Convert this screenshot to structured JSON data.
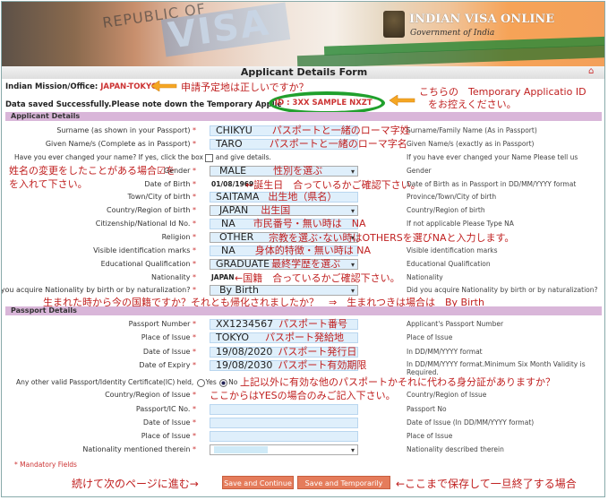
{
  "banner": {
    "title": "INDIAN VISA ONLINE",
    "subtitle": "Government of India"
  },
  "form_title": "Applicant Details Form",
  "mission": {
    "label": "Indian Mission/Office:",
    "value": "JAPAN-TOKYO"
  },
  "saved": {
    "text": "Data saved Successfully.Please note down the Temporary Applic",
    "id_label": "ID :",
    "id_value": "3XX SAMPLE NXZT"
  },
  "sections": {
    "applicant": "Applicant Details",
    "passport": "Passport Details"
  },
  "fields": {
    "surname": {
      "label": "Surname (as shown in your Passport)",
      "value": "CHIKYU",
      "hint": "Surname/Family Name (As in Passport)"
    },
    "given": {
      "label": "Given Name/s (Complete as in Passport)",
      "value": "TARO",
      "hint": "Given Name/s (exactly as in Passport)"
    },
    "changed": {
      "label": "Have you ever changed your name? If yes, click the box",
      "label2": "and give details.",
      "hint": "If you have ever changed your Name Please tell us"
    },
    "gender": {
      "label": "Gender",
      "value": "MALE",
      "hint": "Gender"
    },
    "dob": {
      "label": "Date of Birth",
      "value": "01/08/1969",
      "hint": "Date of Birth as in Passport in DD/MM/YYYY format"
    },
    "town": {
      "label": "Town/City of birth",
      "value": "SAITAMA",
      "hint": "Province/Town/City of birth"
    },
    "country_birth": {
      "label": "Country/Region of birth",
      "value": "JAPAN",
      "hint": "Country/Region of birth"
    },
    "citizen_id": {
      "label": "Citizenship/National Id No.",
      "value": "NA",
      "hint": "If not applicable Please Type NA"
    },
    "religion": {
      "label": "Religion",
      "value": "OTHER",
      "hint": ""
    },
    "visible_marks": {
      "label": "Visible identification marks",
      "value": "NA",
      "hint": "Visible identification marks"
    },
    "education": {
      "label": "Educational Qualification",
      "value": "GRADUATE",
      "hint": "Educational Qualification"
    },
    "nationality": {
      "label": "Nationality",
      "value": "JAPAN",
      "hint": "Nationality"
    },
    "acquire": {
      "label": "Did you acquire Nationality by birth or by naturalization?",
      "value": "By Birth",
      "hint": "Did you acquire Nationality by birth or by naturalization?"
    },
    "passport_no": {
      "label": "Passport Number",
      "value": "XX1234567",
      "hint": "Applicant's Passport Number"
    },
    "place_issue": {
      "label": "Place of Issue",
      "value": "TOKYO",
      "hint": "Place of Issue"
    },
    "date_issue": {
      "label": "Date of Issue",
      "value": "19/08/2020",
      "hint": "In DD/MM/YYYY format"
    },
    "date_expiry": {
      "label": "Date of Expiry",
      "value": "19/08/2030",
      "hint": "In DD/MM/YYYY format.Minimum Six Month Validity is",
      "hint2": "Required."
    },
    "other_passport": {
      "label": "Any other valid Passport/Identity Certificate(IC) held,",
      "yes": "Yes",
      "no": "No"
    },
    "country_issue": {
      "label": "Country/Region of Issue",
      "hint": "Country/Region of Issue"
    },
    "ic_no": {
      "label": "Passport/IC No.",
      "hint": "Passport No"
    },
    "date_issue2": {
      "label": "Date of Issue",
      "hint": "Date of Issue (In DD/MM/YYYY format)"
    },
    "place_issue2": {
      "label": "Place of Issue",
      "hint": "Place of Issue"
    },
    "nationality_therein": {
      "label": "Nationality mentioned therein",
      "hint": "Nationality described therein"
    }
  },
  "mandatory": "* Mandatory Fields",
  "buttons": {
    "continue": "Save and Continue",
    "exit": "Save and Temporarily Exit"
  },
  "annotations": {
    "mission": "申請予定地は正しいですか？",
    "tempid1": "こちらの　Temporary Applicatio ID",
    "tempid2": "をお控えください。",
    "surname": "パスポートと一緒のローマ字姓",
    "given": "パスポートと一緒のローマ字名",
    "changed1": "姓名の変更をしたことがある場合☑を",
    "changed2": "を入れて下さい。",
    "gender": "性別を選ぶ",
    "dob": "←誕生日　合っているかご確認下さい。",
    "town": "出生地（県名）",
    "country_birth": "出生国",
    "citizen_id": "市民番号・無い時は　NA",
    "religion": "宗教を選ぶ･ない時はOTHERSを選びNAと入力します。",
    "marks": "身体的特徴・無い時は NA",
    "education": "最終学歴を選ぶ",
    "nationality": "←国籍　合っているかご確認下さい。",
    "acquire": "生まれた時から今の国籍ですか？それとも帰化されましたか？　⇒　生まれつきは場合は　By Birth",
    "passport_no": "パスポート番号",
    "place_issue": "パスポート発給地",
    "date_issue": "パスポート発行日",
    "date_expiry": "パスポート有効期限",
    "other_passport": "上記以外に有効な他のパスポートかそれに代わる身分証がありますか？",
    "yes_only": "ここからはYESの場合のみご記入下さい。",
    "continue": "続けて次のページに進む→",
    "exit": "←ここまで保存して一旦終了する場合"
  },
  "colors": {
    "section": "#d9b6d9",
    "input": "#dfeffb",
    "button": "#e57c5b",
    "annotation": "#c02020",
    "ellipse": "#20a02c"
  }
}
